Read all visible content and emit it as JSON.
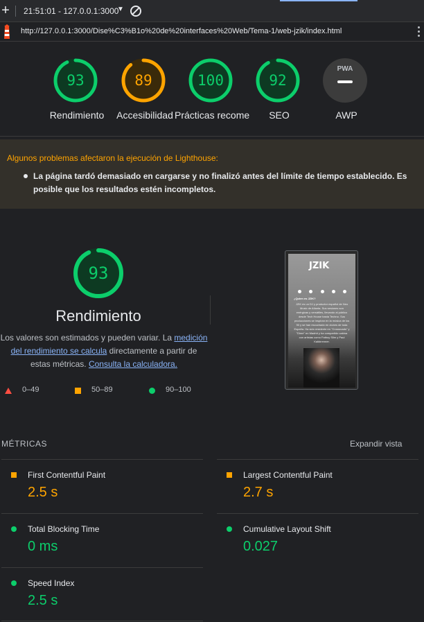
{
  "toolbar": {
    "plus": "+",
    "time_host": "21:51:01 - 127.0.0.1:3000",
    "caret": "▼"
  },
  "url": "http://127.0.0.1:3000/Dise%C3%B1o%20de%20interfaces%20Web/Tema-1/web-jzik/index.html",
  "gauges": [
    {
      "score": "93",
      "label": "Rendimiento",
      "value": 93,
      "color": "#0cce6b",
      "bg": "#0d3a22"
    },
    {
      "score": "89",
      "label": "Accesibilidad",
      "value": 89,
      "color": "#ffa400",
      "bg": "#3a2a0a"
    },
    {
      "score": "100",
      "label": "Prácticas recomendadas",
      "value": 100,
      "color": "#0cce6b",
      "bg": "#0d3a22"
    },
    {
      "score": "92",
      "label": "SEO",
      "value": 92,
      "color": "#0cce6b",
      "bg": "#0d3a22"
    }
  ],
  "pwa": {
    "badge": "PWA",
    "label": "AWP"
  },
  "warning": {
    "title": "Algunos problemas afectaron la ejecución de Lighthouse:",
    "item": "La página tardó demasiado en cargarse y no finalizó antes del límite de tiempo establecido. Es posible que los resultados estén incompletos."
  },
  "performance": {
    "score": "93",
    "value": 93,
    "title": "Rendimiento",
    "desc_1": "Los valores son estimados y pueden variar. La ",
    "desc_link1": "medición del rendimiento se calcula",
    "desc_2": " directamente a partir de estas métricas. ",
    "desc_link2": "Consulta la calculadora."
  },
  "legend": {
    "fail": "0–49",
    "average": "50–89",
    "pass": "90–100"
  },
  "thumbnail": {
    "logo": "JZIK",
    "heading": "¿Quien es JZIK?",
    "body": "JZIK es un DJ y productor español de Neo Music de Atlanta. Sus sesiones son enérgicas y versátiles, llevando al público desde Tech House hasta Techno. Sus producciones se inspiran en la música de los 90 y se han escuchado en clubes de toda España. Ha sido residente en \"Crossroads\" y \"Dime\" en Madrid y ha compartido cabina con artistas como Fatboy Slim y Paul Kalkbrenner."
  },
  "metrics": {
    "heading": "MÉTRICAS",
    "expand": "Expandir vista",
    "items": [
      {
        "name": "First Contentful Paint",
        "value": "2.5 s",
        "status": "orange"
      },
      {
        "name": "Largest Contentful Paint",
        "value": "2.7 s",
        "status": "orange"
      },
      {
        "name": "Total Blocking Time",
        "value": "0 ms",
        "status": "green"
      },
      {
        "name": "Cumulative Layout Shift",
        "value": "0.027",
        "status": "green"
      },
      {
        "name": "Speed Index",
        "value": "2.5 s",
        "status": "green"
      }
    ]
  }
}
